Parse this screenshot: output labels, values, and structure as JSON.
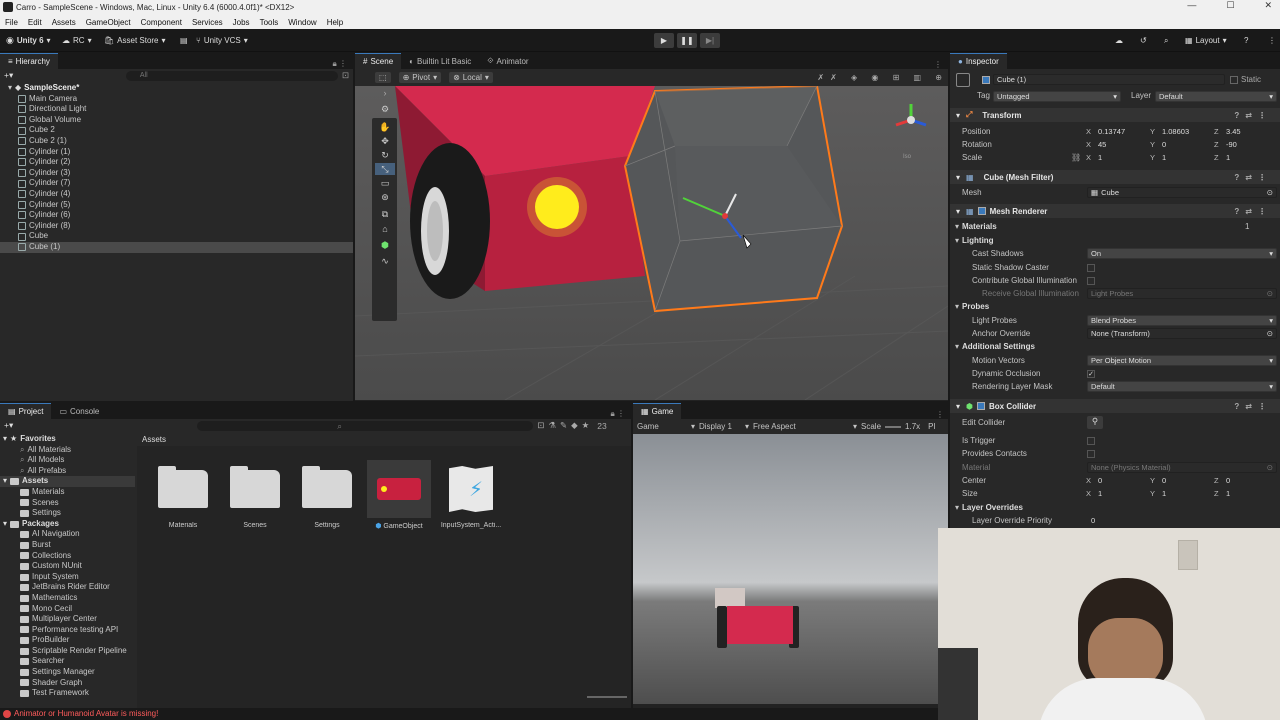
{
  "window": {
    "title": "Carro - SampleScene - Windows, Mac, Linux - Unity 6.4 (6000.4.0f1)* <DX12>"
  },
  "menu": [
    "File",
    "Edit",
    "Assets",
    "GameObject",
    "Component",
    "Services",
    "Jobs",
    "Tools",
    "Window",
    "Help"
  ],
  "toolbar": {
    "account": "Unity 6",
    "rc": "RC",
    "asset_store": "Asset Store",
    "vcs": "Unity VCS",
    "layout": "Layout"
  },
  "hierarchy": {
    "tab": "Hierarchy",
    "search_placeholder": "All",
    "scene": "SampleScene*",
    "items": [
      "Main Camera",
      "Directional Light",
      "Global Volume",
      "Cube 2",
      "Cube 2 (1)",
      "Cylinder (1)",
      "Cylinder (2)",
      "Cylinder (3)",
      "Cylinder (7)",
      "Cylinder (4)",
      "Cylinder (5)",
      "Cylinder (6)",
      "Cylinder (8)",
      "Cube",
      "Cube (1)"
    ],
    "selected": "Cube (1)"
  },
  "scene_view": {
    "tabs": [
      "Scene",
      "Builtin Lit Basic",
      "Animator"
    ],
    "pivot": "Pivot",
    "local": "Local",
    "gizmo_label": "Iso"
  },
  "inspector": {
    "tab": "Inspector",
    "object_name": "Cube (1)",
    "static_label": "Static",
    "tag_label": "Tag",
    "tag": "Untagged",
    "layer_label": "Layer",
    "layer": "Default",
    "transform": {
      "title": "Transform",
      "position_label": "Position",
      "position": {
        "x": "0.13747",
        "y": "1.08603",
        "z": "3.45"
      },
      "rotation_label": "Rotation",
      "rotation": {
        "x": "45",
        "y": "0",
        "z": "-90"
      },
      "scale_label": "Scale",
      "scale": {
        "x": "1",
        "y": "1",
        "z": "1"
      }
    },
    "mesh_filter": {
      "title": "Cube (Mesh Filter)",
      "mesh_label": "Mesh",
      "mesh": "Cube"
    },
    "mesh_renderer": {
      "title": "Mesh Renderer",
      "materials_label": "Materials",
      "materials_count": "1",
      "lighting": "Lighting",
      "cast_shadows_label": "Cast Shadows",
      "cast_shadows": "On",
      "static_shadow_label": "Static Shadow Caster",
      "contribute_gi_label": "Contribute Global Illumination",
      "receive_gi_label": "Receive Global Illumination",
      "receive_gi": "Light Probes",
      "probes": "Probes",
      "light_probes_label": "Light Probes",
      "light_probes": "Blend Probes",
      "anchor_label": "Anchor Override",
      "anchor": "None (Transform)",
      "additional": "Additional Settings",
      "motion_label": "Motion Vectors",
      "motion": "Per Object Motion",
      "dyn_occ_label": "Dynamic Occlusion",
      "rlm_label": "Rendering Layer Mask",
      "rlm": "Default"
    },
    "box_collider": {
      "title": "Box Collider",
      "edit_label": "Edit Collider",
      "trigger_label": "Is Trigger",
      "contacts_label": "Provides Contacts",
      "material_label": "Material",
      "material": "None (Physics Material)",
      "center_label": "Center",
      "center": {
        "x": "0",
        "y": "0",
        "z": "0"
      },
      "size_label": "Size",
      "size": {
        "x": "1",
        "y": "1",
        "z": "1"
      },
      "overrides": "Layer Overrides",
      "priority_label": "Layer Override Priority",
      "priority": "0"
    }
  },
  "project": {
    "tabs": [
      "Project",
      "Console"
    ],
    "count": "23",
    "favorites": "Favorites",
    "fav_items": [
      "All Materials",
      "All Models",
      "All Prefabs"
    ],
    "assets_label": "Assets",
    "asset_folders": [
      "Materials",
      "Scenes",
      "Settings"
    ],
    "packages_label": "Packages",
    "packages": [
      "AI Navigation",
      "Burst",
      "Collections",
      "Custom NUnit",
      "Input System",
      "JetBrains Rider Editor",
      "Mathematics",
      "Mono Cecil",
      "Multiplayer Center",
      "Performance testing API",
      "ProBuilder",
      "Scriptable Render Pipeline",
      "Searcher",
      "Settings Manager",
      "Shader Graph",
      "Test Framework"
    ],
    "breadcrumb": "Assets",
    "grid": [
      "Materials",
      "Scenes",
      "Settings",
      "GameObject",
      "InputSystem_Acti..."
    ]
  },
  "game_view": {
    "tab": "Game",
    "mode": "Game",
    "display": "Display 1",
    "aspect": "Free Aspect",
    "scale_label": "Scale",
    "scale": "1.7x",
    "extra": "Pl"
  },
  "status": {
    "message": "Animator or Humanoid Avatar is missing!"
  },
  "colors": {
    "accent": "#3a79bb",
    "car_red": "#d42a4e",
    "selection_orange": "#ff7a1a",
    "error": "#ff5c5c"
  }
}
